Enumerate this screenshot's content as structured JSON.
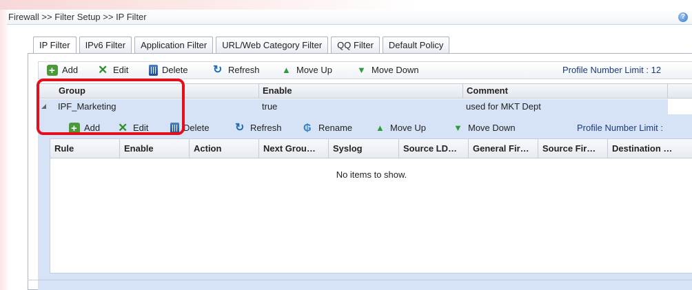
{
  "breadcrumb": "Firewall >> Filter Setup >> IP Filter",
  "tabs": [
    {
      "label": "IP Filter",
      "active": true
    },
    {
      "label": "IPv6 Filter"
    },
    {
      "label": "Application Filter"
    },
    {
      "label": "URL/Web Category Filter"
    },
    {
      "label": "QQ Filter"
    },
    {
      "label": "Default Policy"
    }
  ],
  "toolbar": {
    "add": "Add",
    "edit": "Edit",
    "delete": "Delete",
    "refresh": "Refresh",
    "move_up": "Move Up",
    "move_down": "Move Down",
    "profile_limit": "Profile Number Limit : 12"
  },
  "grid": {
    "columns": [
      "Group",
      "Enable",
      "Comment"
    ],
    "rows": [
      {
        "group": "IPF_Marketing",
        "enable": "true",
        "comment": "used for MKT Dept"
      }
    ]
  },
  "sub_toolbar": {
    "add": "Add",
    "edit": "Edit",
    "delete": "Delete",
    "refresh": "Refresh",
    "rename": "Rename",
    "move_up": "Move Up",
    "move_down": "Move Down",
    "profile_limit": "Profile Number Limit :"
  },
  "sub_grid": {
    "columns": [
      "Rule",
      "Enable",
      "Action",
      "Next Grou…",
      "Syslog",
      "Source LD…",
      "General Fir…",
      "Source Fir…",
      "Destination …"
    ],
    "empty_message": "No items to show."
  },
  "colors": {
    "highlight": "#e3101c",
    "selected_row": "#d6e3f6"
  }
}
